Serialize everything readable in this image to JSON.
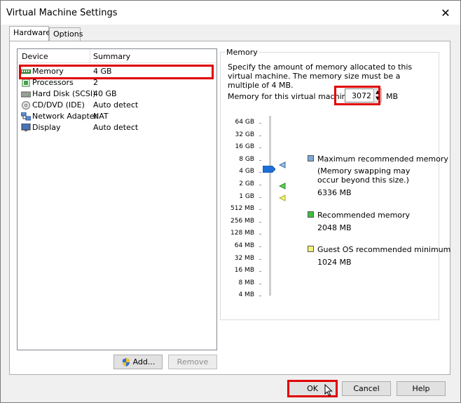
{
  "window": {
    "title": "Virtual Machine Settings"
  },
  "tabs": [
    {
      "label": "Hardware"
    },
    {
      "label": "Options"
    }
  ],
  "device_list": {
    "headers": {
      "device": "Device",
      "summary": "Summary"
    },
    "rows": [
      {
        "icon": "memory-icon",
        "device": "Memory",
        "summary": "4 GB"
      },
      {
        "icon": "processor-icon",
        "device": "Processors",
        "summary": "2"
      },
      {
        "icon": "hard-disk-icon",
        "device": "Hard Disk (SCSI)",
        "summary": "40 GB"
      },
      {
        "icon": "cd-dvd-icon",
        "device": "CD/DVD (IDE)",
        "summary": "Auto detect"
      },
      {
        "icon": "network-adapter-icon",
        "device": "Network Adapter",
        "summary": "NAT"
      },
      {
        "icon": "display-icon",
        "device": "Display",
        "summary": "Auto detect"
      }
    ]
  },
  "buttons": {
    "add": "Add...",
    "remove": "Remove",
    "ok": "OK",
    "cancel": "Cancel",
    "help": "Help"
  },
  "memory": {
    "group_title": "Memory",
    "description": "Specify the amount of memory allocated to this virtual machine. The memory size must be a multiple of 4 MB.",
    "field_label": "Memory for this virtual machine:",
    "value": "3072",
    "unit": "MB",
    "scale": [
      "64 GB",
      "32 GB",
      "16 GB",
      "8 GB",
      "4 GB",
      "2 GB",
      "1 GB",
      "512 MB",
      "256 MB",
      "128 MB",
      "64 MB",
      "32 MB",
      "16 MB",
      "8 MB",
      "4 MB"
    ],
    "legend": {
      "max": {
        "label": "Maximum recommended memory",
        "note1": "(Memory swapping may",
        "note2": "occur beyond this size.)",
        "value": "6336 MB",
        "color": "#7fa7d8"
      },
      "recommended": {
        "label": "Recommended memory",
        "value": "2048 MB",
        "color": "#3fbf3f"
      },
      "guest_min": {
        "label": "Guest OS recommended minimum",
        "value": "1024 MB",
        "color": "#f2f27a"
      }
    }
  }
}
